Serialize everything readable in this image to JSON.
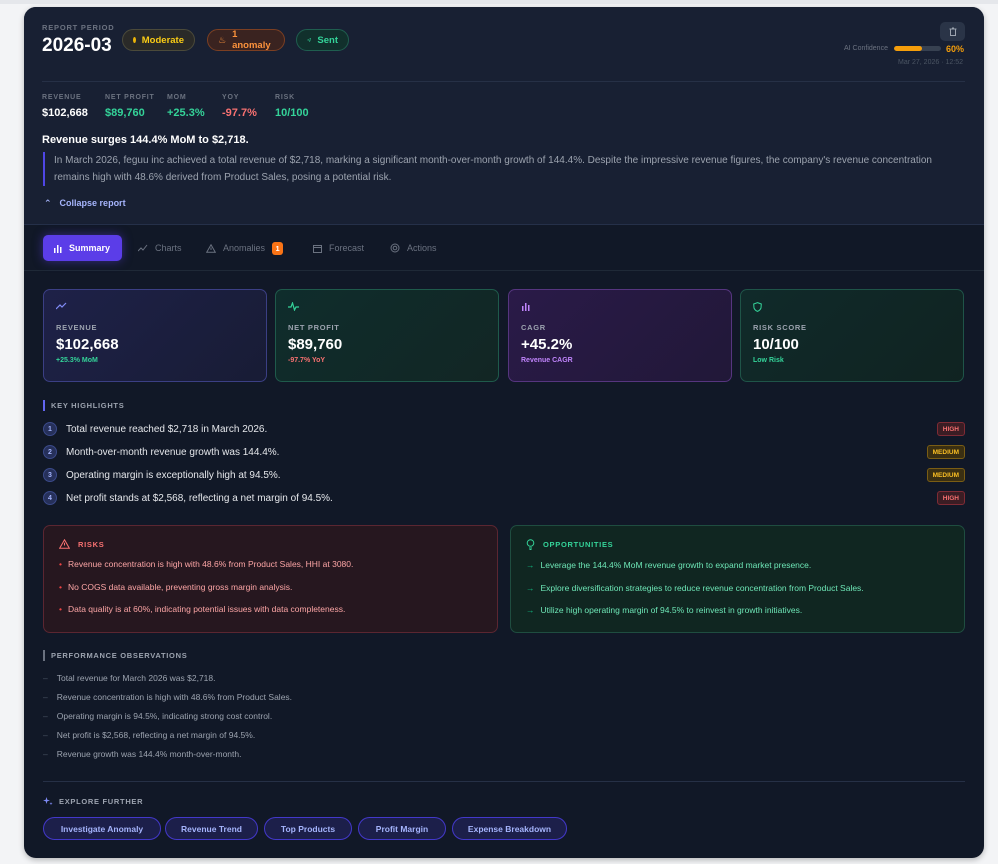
{
  "header": {
    "period_label": "REPORT PERIOD",
    "period_value": "2026-03",
    "badges": {
      "moderate": "Moderate",
      "anomaly": "1 anomaly",
      "sent": "Sent"
    },
    "confidence_label": "AI Confidence",
    "confidence_value": "60%",
    "confidence_fraction": 0.6,
    "timestamp": "Mar 27, 2026 · 12:52"
  },
  "metrics": [
    {
      "label": "REVENUE",
      "value": "$102,668",
      "color": "#ffffff"
    },
    {
      "label": "NET PROFIT",
      "value": "$89,760",
      "color": "#34d399"
    },
    {
      "label": "MOM",
      "value": "+25.3%",
      "color": "#34d399"
    },
    {
      "label": "YOY",
      "value": "-97.7%",
      "color": "#f87171"
    },
    {
      "label": "RISK",
      "value": "10/100",
      "color": "#34d399"
    }
  ],
  "summary": {
    "title": "Revenue surges 144.4% MoM to $2,718.",
    "body": "In March 2026, feguu inc achieved a total revenue of $2,718, marking a significant month-over-month growth of 144.4%. Despite the impressive revenue figures, the company's revenue concentration remains high with 48.6% derived from Product Sales, posing a potential risk.",
    "collapse_label": "Collapse report"
  },
  "tabs": [
    {
      "label": "Summary",
      "icon": "bar-chart-icon",
      "active": true
    },
    {
      "label": "Charts",
      "icon": "trend-icon"
    },
    {
      "label": "Anomalies",
      "icon": "warning-icon",
      "count": "1"
    },
    {
      "label": "Forecast",
      "icon": "calendar-icon"
    },
    {
      "label": "Actions",
      "icon": "target-icon"
    }
  ],
  "kpis": [
    {
      "label": "REVENUE",
      "value": "$102,668",
      "sub": "+25.3% MoM",
      "icon": "trend-up-icon",
      "accent": "#818cf8",
      "sub_color": "#34d399"
    },
    {
      "label": "NET PROFIT",
      "value": "$89,760",
      "sub": "-97.7% YoY",
      "icon": "activity-icon",
      "accent": "#34d399",
      "sub_color": "#f87171"
    },
    {
      "label": "CAGR",
      "value": "+45.2%",
      "sub": "Revenue CAGR",
      "icon": "bar-chart-icon",
      "accent": "#c084fc",
      "sub_color": "#c084fc"
    },
    {
      "label": "RISK SCORE",
      "value": "10/100",
      "sub": "Low Risk",
      "icon": "shield-icon",
      "accent": "#34d399",
      "sub_color": "#34d399"
    }
  ],
  "highlights": {
    "title": "KEY HIGHLIGHTS",
    "items": [
      {
        "num": "1",
        "text": "Total revenue reached $2,718 in March 2026.",
        "level": "HIGH"
      },
      {
        "num": "2",
        "text": "Month-over-month revenue growth was 144.4%.",
        "level": "MEDIUM"
      },
      {
        "num": "3",
        "text": "Operating margin is exceptionally high at 94.5%.",
        "level": "MEDIUM"
      },
      {
        "num": "4",
        "text": "Net profit stands at $2,568, reflecting a net margin of 94.5%.",
        "level": "HIGH"
      }
    ]
  },
  "risks": {
    "title": "RISKS",
    "items": [
      "Revenue concentration is high with 48.6% from Product Sales, HHI at 3080.",
      "No COGS data available, preventing gross margin analysis.",
      "Data quality is at 60%, indicating potential issues with data completeness."
    ]
  },
  "opportunities": {
    "title": "OPPORTUNITIES",
    "items": [
      "Leverage the 144.4% MoM revenue growth to expand market presence.",
      "Explore diversification strategies to reduce revenue concentration from Product Sales.",
      "Utilize high operating margin of 94.5% to reinvest in growth initiatives."
    ]
  },
  "observations": {
    "title": "PERFORMANCE OBSERVATIONS",
    "items": [
      "Total revenue for March 2026 was $2,718.",
      "Revenue concentration is high with 48.6% from Product Sales.",
      "Operating margin is 94.5%, indicating strong cost control.",
      "Net profit is $2,568, reflecting a net margin of 94.5%.",
      "Revenue growth was 144.4% month-over-month."
    ]
  },
  "explore": {
    "title": "EXPLORE FURTHER",
    "chips": [
      "Investigate Anomaly",
      "Revenue Trend",
      "Top Products",
      "Profit Margin",
      "Expense Breakdown"
    ]
  }
}
